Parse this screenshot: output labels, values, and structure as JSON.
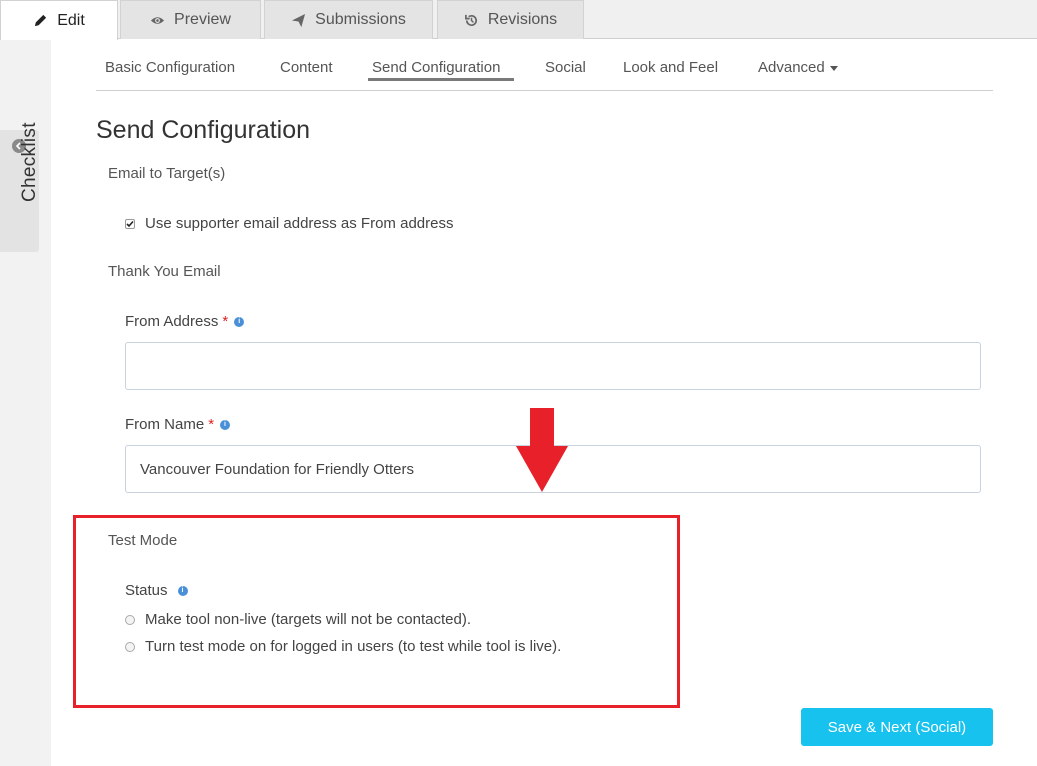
{
  "top_tabs": [
    {
      "label": "Edit",
      "icon": "pencil-icon",
      "active": true
    },
    {
      "label": "Preview",
      "icon": "eye-icon",
      "active": false
    },
    {
      "label": "Submissions",
      "icon": "paper-plane-icon",
      "active": false
    },
    {
      "label": "Revisions",
      "icon": "history-icon",
      "active": false
    }
  ],
  "sidebar": {
    "checklist_label": "Checklist"
  },
  "sub_tabs": [
    {
      "label": "Basic Configuration"
    },
    {
      "label": "Content"
    },
    {
      "label": "Send Configuration",
      "active": true
    },
    {
      "label": "Social"
    },
    {
      "label": "Look and Feel"
    },
    {
      "label": "Advanced"
    }
  ],
  "page": {
    "title": "Send Configuration"
  },
  "email_targets": {
    "heading": "Email to Target(s)",
    "use_supporter_label": "Use supporter email address as From address",
    "use_supporter_checked": true
  },
  "thank_you": {
    "heading": "Thank You Email",
    "from_address_label": "From Address",
    "from_address_value": "",
    "from_name_label": "From Name",
    "from_name_value": "Vancouver Foundation for Friendly Otters",
    "required_mark": "*"
  },
  "test_mode": {
    "heading": "Test Mode",
    "status_label": "Status",
    "options": [
      "Make tool non-live (targets will not be contacted).",
      "Turn test mode on for logged in users (to test while tool is live)."
    ]
  },
  "footer": {
    "save_label": "Save & Next (Social)"
  },
  "colors": {
    "accent_button": "#17c3ee",
    "annotation_red": "#e8202a",
    "required": "#e02020",
    "info": "#4a90d9"
  }
}
